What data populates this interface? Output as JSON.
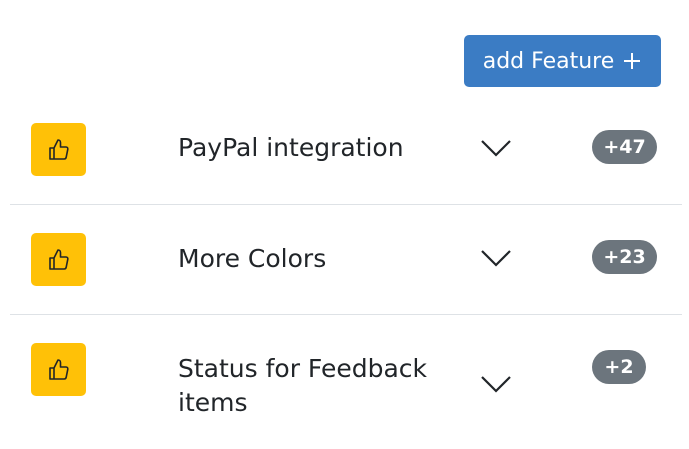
{
  "header": {
    "add_feature_label": "add Feature"
  },
  "features": [
    {
      "title": "PayPal integration",
      "votes": "+47"
    },
    {
      "title": "More Colors",
      "votes": "+23"
    },
    {
      "title": "Status for Feedback items",
      "votes": "+2"
    }
  ],
  "colors": {
    "primary": "#3b7cc4",
    "warning": "#ffc107",
    "badge": "#6c757d",
    "divider": "#dee2e6"
  }
}
